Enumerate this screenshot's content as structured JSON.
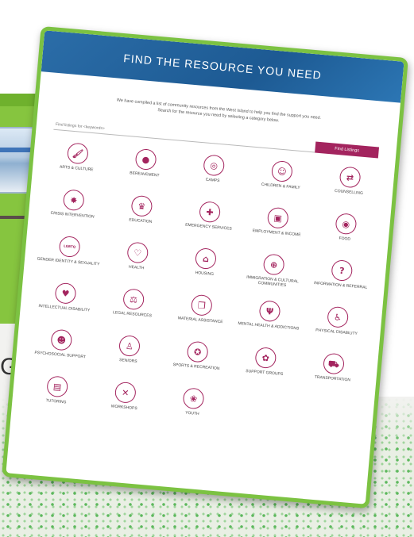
{
  "background": {
    "partial_word": "GA"
  },
  "card": {
    "title": "FIND THE RESOURCE YOU NEED",
    "intro_line1": "We have compiled a list of community resources from the West Island to help you find the support you need.",
    "intro_line2": "Search for the resource you need by selecting a category below.",
    "search_placeholder": "Find listings for <keywords>",
    "search_button": "Find Listings",
    "accent_color": "#a3245e",
    "border_color": "#7cc242",
    "header_color": "#2b6da8"
  },
  "categories": [
    {
      "label": "ARTS & CULTURE",
      "icon": "paintbrush-icon",
      "glyph": "🖌"
    },
    {
      "label": "BEREAVEMENT",
      "icon": "dot-icon",
      "glyph": "●"
    },
    {
      "label": "CAMPS",
      "icon": "lifebuoy-icon",
      "glyph": "◎"
    },
    {
      "label": "CHILDREN & FAMILY",
      "icon": "family-icon",
      "glyph": "☺"
    },
    {
      "label": "COUNSELLING",
      "icon": "signpost-icon",
      "glyph": "⇄"
    },
    {
      "label": "CRISIS INTERVENTION",
      "icon": "alert-badge-icon",
      "glyph": "✸"
    },
    {
      "label": "EDUCATION",
      "icon": "graduation-cap-icon",
      "glyph": "♛"
    },
    {
      "label": "EMERGENCY SERVICES",
      "icon": "ambulance-icon",
      "glyph": "✚"
    },
    {
      "label": "EMPLOYMENT & INCOME",
      "icon": "briefcase-icon",
      "glyph": "▣"
    },
    {
      "label": "FOOD",
      "icon": "food-icon",
      "glyph": "◉"
    },
    {
      "label": "GENDER IDENTITY & SEXUALITY",
      "icon": "lgbtq-icon",
      "glyph": "LGBTQ"
    },
    {
      "label": "HEALTH",
      "icon": "heart-pulse-icon",
      "glyph": "♡"
    },
    {
      "label": "HOUSING",
      "icon": "house-icon",
      "glyph": "⌂"
    },
    {
      "label": "IMMIGRATION & CULTURAL COMMUNITIES",
      "icon": "globe-icon",
      "glyph": "⊕"
    },
    {
      "label": "INFORMATION & REFERRAL",
      "icon": "question-icon",
      "glyph": "?"
    },
    {
      "label": "INTELLECTUAL DISABILITY",
      "icon": "heart-icon",
      "glyph": "♥"
    },
    {
      "label": "LEGAL RESOURCES",
      "icon": "scales-icon",
      "glyph": "⚖"
    },
    {
      "label": "MATERIAL ASSISTANCE",
      "icon": "box-icon",
      "glyph": "❒"
    },
    {
      "label": "MENTAL HEALTH & ADDICTIONS",
      "icon": "psi-icon",
      "glyph": "Ψ"
    },
    {
      "label": "PHYSICAL DISABILITY",
      "icon": "wheelchair-icon",
      "glyph": "♿"
    },
    {
      "label": "PSYCHOSOCIAL SUPPORT",
      "icon": "head-icon",
      "glyph": "☻"
    },
    {
      "label": "SENIORS",
      "icon": "cane-icon",
      "glyph": "♙"
    },
    {
      "label": "SPORTS & RECREATION",
      "icon": "medal-icon",
      "glyph": "✪"
    },
    {
      "label": "SUPPORT GROUPS",
      "icon": "group-icon",
      "glyph": "✿"
    },
    {
      "label": "TRANSPORTATION",
      "icon": "car-icon",
      "glyph": "⛟"
    },
    {
      "label": "TUTORING",
      "icon": "book-icon",
      "glyph": "▤"
    },
    {
      "label": "WORKSHOPS",
      "icon": "tools-icon",
      "glyph": "✕"
    },
    {
      "label": "YOUTH",
      "icon": "flower-icon",
      "glyph": "❀"
    }
  ]
}
